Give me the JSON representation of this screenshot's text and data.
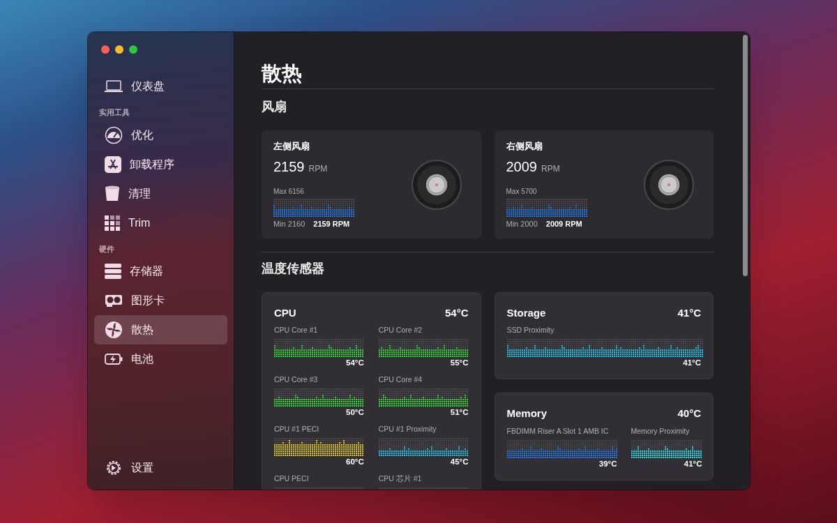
{
  "sidebar": {
    "top_items": [
      {
        "label": "仪表盘",
        "selected": false
      }
    ],
    "sections": [
      {
        "heading": "实用工具",
        "items": [
          {
            "label": "优化",
            "selected": false
          },
          {
            "label": "卸载程序",
            "selected": false
          },
          {
            "label": "清理",
            "selected": false
          },
          {
            "label": "Trim",
            "selected": false
          }
        ]
      },
      {
        "heading": "硬件",
        "items": [
          {
            "label": "存储器",
            "selected": false
          },
          {
            "label": "图形卡",
            "selected": false
          },
          {
            "label": "散热",
            "selected": true
          },
          {
            "label": "电池",
            "selected": false
          }
        ]
      }
    ],
    "footer_item": {
      "label": "设置",
      "selected": false
    }
  },
  "main": {
    "title": "散热",
    "fans": {
      "heading": "风扇",
      "items": [
        {
          "name": "左侧风扇",
          "speed": "2159",
          "unit": "RPM",
          "max": "Max 6156",
          "min": "Min 2160",
          "current": "2159 RPM",
          "color": "#1e7be6"
        },
        {
          "name": "右侧风扇",
          "speed": "2009",
          "unit": "RPM",
          "max": "Max 5700",
          "min": "Min 2000",
          "current": "2009 RPM",
          "color": "#1e7be6"
        }
      ]
    },
    "sensors": {
      "heading": "温度传感器",
      "columns": [
        [
          {
            "name": "CPU",
            "temp": "54°C",
            "sensors": [
              {
                "name": "CPU Core #1",
                "temp": "54°C",
                "color": "#35d83a"
              },
              {
                "name": "CPU Core #2",
                "temp": "55°C",
                "color": "#35d83a"
              },
              {
                "name": "CPU Core #3",
                "temp": "50°C",
                "color": "#35d83a"
              },
              {
                "name": "CPU Core #4",
                "temp": "51°C",
                "color": "#35d83a"
              },
              {
                "name": "CPU #1 PECI",
                "temp": "60°C",
                "color": "#e8d200"
              },
              {
                "name": "CPU #1 Proximity",
                "temp": "45°C",
                "color": "#1ec8e8"
              },
              {
                "name": "CPU PECI"
              },
              {
                "name": "CPU 芯片 #1"
              }
            ]
          }
        ],
        [
          {
            "name": "Storage",
            "temp": "41°C",
            "sensors": [
              {
                "name": "SSD Proximity",
                "temp": "41°C",
                "color": "#1ec8e8"
              }
            ]
          },
          {
            "name": "Memory",
            "temp": "40°C",
            "sensors": [
              {
                "name": "FBDIMM Riser A Slot 1 AMB IC",
                "temp": "39°C",
                "color": "#1e7be6"
              },
              {
                "name": "Memory Proximity",
                "temp": "41°C",
                "color": "#1ee0e8"
              }
            ]
          }
        ]
      ]
    }
  }
}
